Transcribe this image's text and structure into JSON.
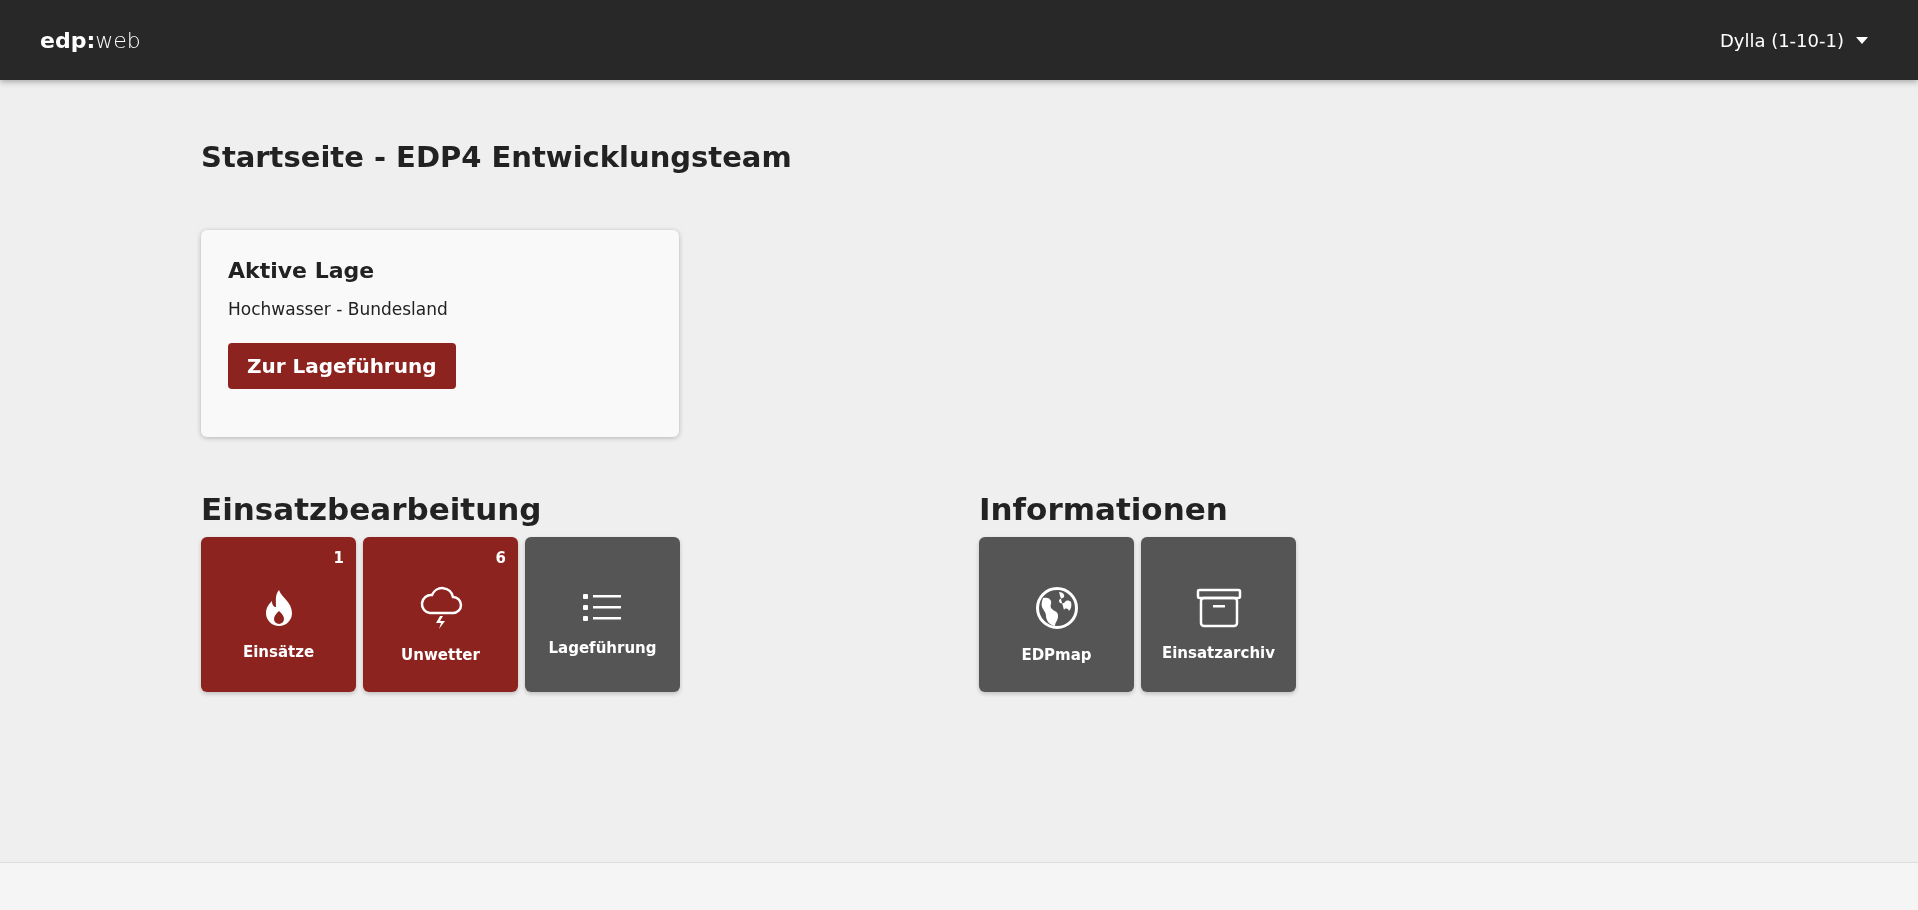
{
  "navbar": {
    "brand": "**edp:**web",
    "user_menu": "Dylla (1-10-1)"
  },
  "page_title": "Startseite - EDP4 Entwicklungsteam",
  "active_card": {
    "title": "Aktive Lage",
    "text": "Hochwasser - Bundesland",
    "button": "Zur Lageführung"
  },
  "sections": [
    {
      "title": "Einsatzbearbeitung",
      "tiles": [
        {
          "kind": "fire",
          "label": "Einsätze",
          "badge": "1",
          "color": "#8c231f"
        },
        {
          "kind": "storm",
          "label": "Unwetter",
          "badge": "6",
          "color": "#8c231f"
        },
        {
          "kind": "list",
          "label": "Lageführung",
          "color": "#555555"
        }
      ]
    },
    {
      "title": "Informationen",
      "tiles": [
        {
          "kind": "globe",
          "label": "EDPmap",
          "color": "#555555"
        },
        {
          "kind": "archive",
          "label": "Einsatzarchiv",
          "color": "#555555"
        }
      ]
    }
  ]
}
